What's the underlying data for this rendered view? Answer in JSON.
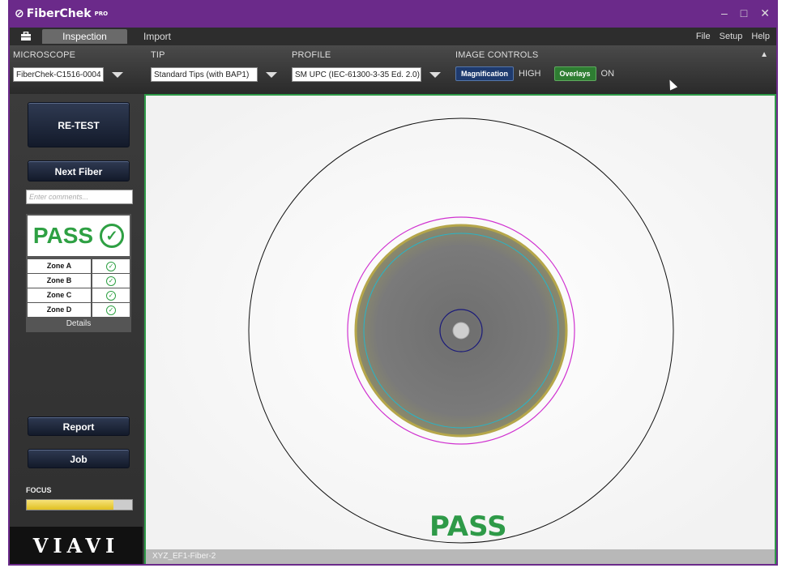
{
  "window": {
    "title": "FiberChek",
    "title_sup": "PRO",
    "controls": [
      "–",
      "□",
      "✕"
    ]
  },
  "menubar": {
    "tabs": [
      {
        "label": "Inspection",
        "active": true
      },
      {
        "label": "Import",
        "active": false
      }
    ],
    "right": [
      "File",
      "Setup",
      "Help"
    ]
  },
  "controls": {
    "microscope": {
      "label": "MICROSCOPE",
      "value": "FiberChek-C1516-0004"
    },
    "tip": {
      "label": "TIP",
      "value": "Standard Tips (with BAP1)"
    },
    "profile": {
      "label": "PROFILE",
      "value": "SM UPC (IEC-61300-3-35 Ed. 2.0)"
    },
    "image_controls": {
      "label": "IMAGE CONTROLS",
      "magnification_label": "Magnification",
      "magnification_value": "HIGH",
      "overlays_label": "Overlays",
      "overlays_value": "ON"
    }
  },
  "sidebar": {
    "retest": "RE-TEST",
    "next_fiber": "Next Fiber",
    "comments_placeholder": "Enter comments...",
    "result": "PASS",
    "zones": [
      {
        "name": "Zone A",
        "status": "pass"
      },
      {
        "name": "Zone B",
        "status": "pass"
      },
      {
        "name": "Zone C",
        "status": "pass"
      },
      {
        "name": "Zone D",
        "status": "pass"
      }
    ],
    "details": "Details",
    "report": "Report",
    "job": "Job",
    "focus_label": "FOCUS",
    "focus_level": 0.82,
    "logo": "VIAVI"
  },
  "viewer": {
    "result": "PASS",
    "filename": "XYZ_EF1-Fiber-2",
    "colors": {
      "zone_a": "#1a1a7a",
      "zone_b": "#27b5c8",
      "zone_c": "#d032d0",
      "zone_d": "#111111",
      "pass": "#2e9a48"
    }
  }
}
